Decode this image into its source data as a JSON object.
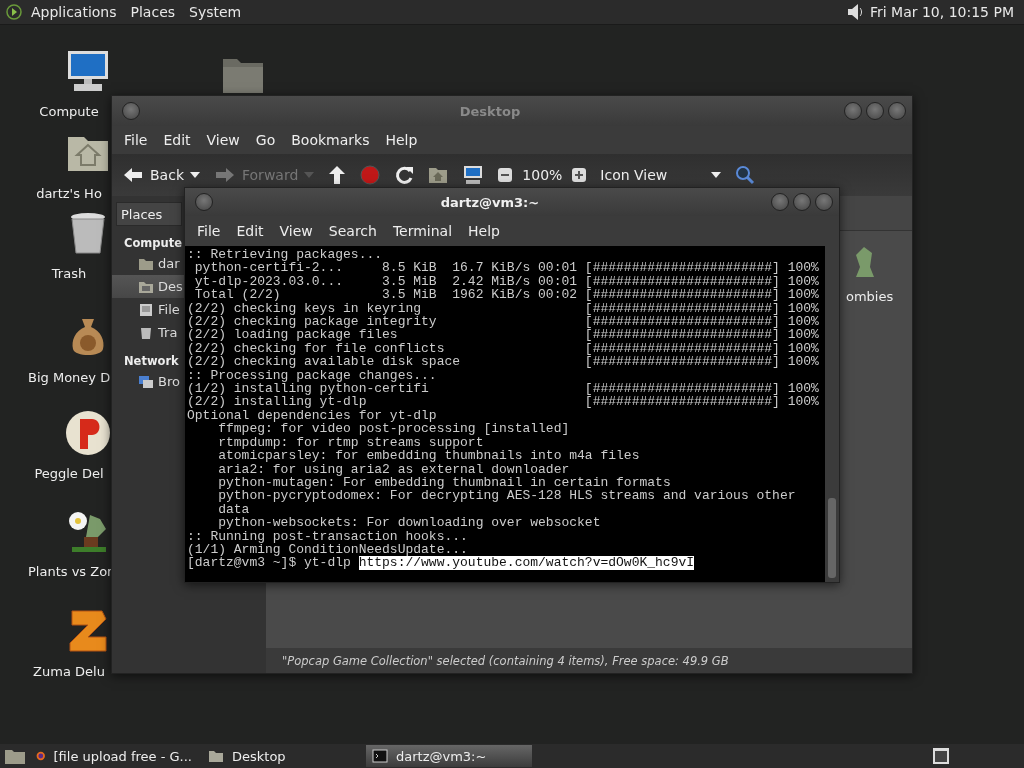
{
  "top_panel": {
    "menus": [
      {
        "label": "Applications"
      },
      {
        "label": "Places"
      },
      {
        "label": "System"
      }
    ],
    "clock": "Fri Mar 10, 10:15 PM"
  },
  "desktop_icons": [
    {
      "kind": "computer",
      "label": "Compute"
    },
    {
      "kind": "home",
      "label": "dartz's Ho"
    },
    {
      "kind": "trash",
      "label": "Trash"
    },
    {
      "kind": "money",
      "label": "Big Money D"
    },
    {
      "kind": "peggle",
      "label": "Peggle Del"
    },
    {
      "kind": "plants",
      "label": "Plants vs Zor"
    },
    {
      "kind": "zuma",
      "label": "Zuma Delu"
    },
    {
      "kind": "folder"
    }
  ],
  "file_manager": {
    "title": "Desktop",
    "menu": [
      "File",
      "Edit",
      "View",
      "Go",
      "Bookmarks",
      "Help"
    ],
    "toolbar": [
      {
        "kind": "back",
        "label": "Back",
        "disabled": false
      },
      {
        "kind": "forward",
        "label": "Forward",
        "disabled": true
      },
      {
        "kind": "up"
      },
      {
        "kind": "stop"
      },
      {
        "kind": "reload"
      },
      {
        "kind": "home"
      },
      {
        "kind": "computer"
      },
      {
        "kind": "zoom_out"
      },
      {
        "kind": "zoom_level",
        "label": "100%"
      },
      {
        "kind": "zoom_in"
      },
      {
        "kind": "view_select",
        "label": "Icon View"
      },
      {
        "kind": "search"
      }
    ],
    "sidebar": {
      "header": "Places",
      "sections": [
        {
          "title": "Compute",
          "items": [
            {
              "kind": "home",
              "label": "dar",
              "selected": false
            },
            {
              "kind": "desktop",
              "label": "Des",
              "selected": true
            },
            {
              "kind": "drive",
              "label": "File",
              "selected": false
            },
            {
              "kind": "trash",
              "label": "Tra",
              "selected": false
            }
          ]
        },
        {
          "title": "Network",
          "items": [
            {
              "kind": "network",
              "label": "Bro",
              "selected": false
            }
          ]
        }
      ]
    },
    "files": [
      {
        "label": "ombies"
      }
    ],
    "status": "\"Popcap Game Collection\" selected (containing 4 items), Free space: 49.9 GB"
  },
  "terminal": {
    "title": "dartz@vm3:~",
    "menu": [
      "File",
      "Edit",
      "View",
      "Search",
      "Terminal",
      "Help"
    ],
    "lines": [
      {
        "text": ":: Retrieving packages..."
      },
      {
        "text": " python-certifi-2...     8.5 KiB  16.7 KiB/s 00:01",
        "bar": "[#######################]",
        "percent": "100%"
      },
      {
        "text": " yt-dlp-2023.03.0...     3.5 MiB  2.42 MiB/s 00:01",
        "bar": "[#######################]",
        "percent": "100%"
      },
      {
        "text": " Total (2/2)             3.5 MiB  1962 KiB/s 00:02",
        "bar": "[#######################]",
        "percent": "100%"
      },
      {
        "text": "(2/2) checking keys in keyring",
        "bar": "[#######################]",
        "percent": "100%"
      },
      {
        "text": "(2/2) checking package integrity",
        "bar": "[#######################]",
        "percent": "100%"
      },
      {
        "text": "(2/2) loading package files",
        "bar": "[#######################]",
        "percent": "100%"
      },
      {
        "text": "(2/2) checking for file conflicts",
        "bar": "[#######################]",
        "percent": "100%"
      },
      {
        "text": "(2/2) checking available disk space",
        "bar": "[#######################]",
        "percent": "100%"
      },
      {
        "text": ":: Processing package changes..."
      },
      {
        "text": "(1/2) installing python-certifi",
        "bar": "[#######################]",
        "percent": "100%"
      },
      {
        "text": "(2/2) installing yt-dlp",
        "bar": "[#######################]",
        "percent": "100%"
      },
      {
        "text": "Optional dependencies for yt-dlp"
      },
      {
        "text": "    ffmpeg: for video post-processing [installed]"
      },
      {
        "text": "    rtmpdump: for rtmp streams support"
      },
      {
        "text": "    atomicparsley: for embedding thumbnails into m4a files"
      },
      {
        "text": "    aria2: for using aria2 as external downloader"
      },
      {
        "text": "    python-mutagen: For embedding thumbnail in certain formats"
      },
      {
        "text": "    python-pycryptodomex: For decrypting AES-128 HLS streams and various other"
      },
      {
        "text": "    data"
      },
      {
        "text": "    python-websockets: For downloading over websocket"
      },
      {
        "text": ":: Running post-transaction hooks..."
      },
      {
        "text": "(1/1) Arming ConditionNeedsUpdate..."
      }
    ],
    "prompt": "[dartz@vm3 ~]$ yt-dlp",
    "selection": "https://www.youtube.com/watch?v=dOw0K_hc9vI"
  },
  "taskbar": {
    "items": [
      {
        "kind": "browser",
        "label": "[file upload free - G...",
        "selected": false
      },
      {
        "kind": "folder",
        "label": "Desktop",
        "selected": false
      },
      {
        "kind": "terminal",
        "label": "dartz@vm3:~",
        "selected": true
      }
    ]
  }
}
